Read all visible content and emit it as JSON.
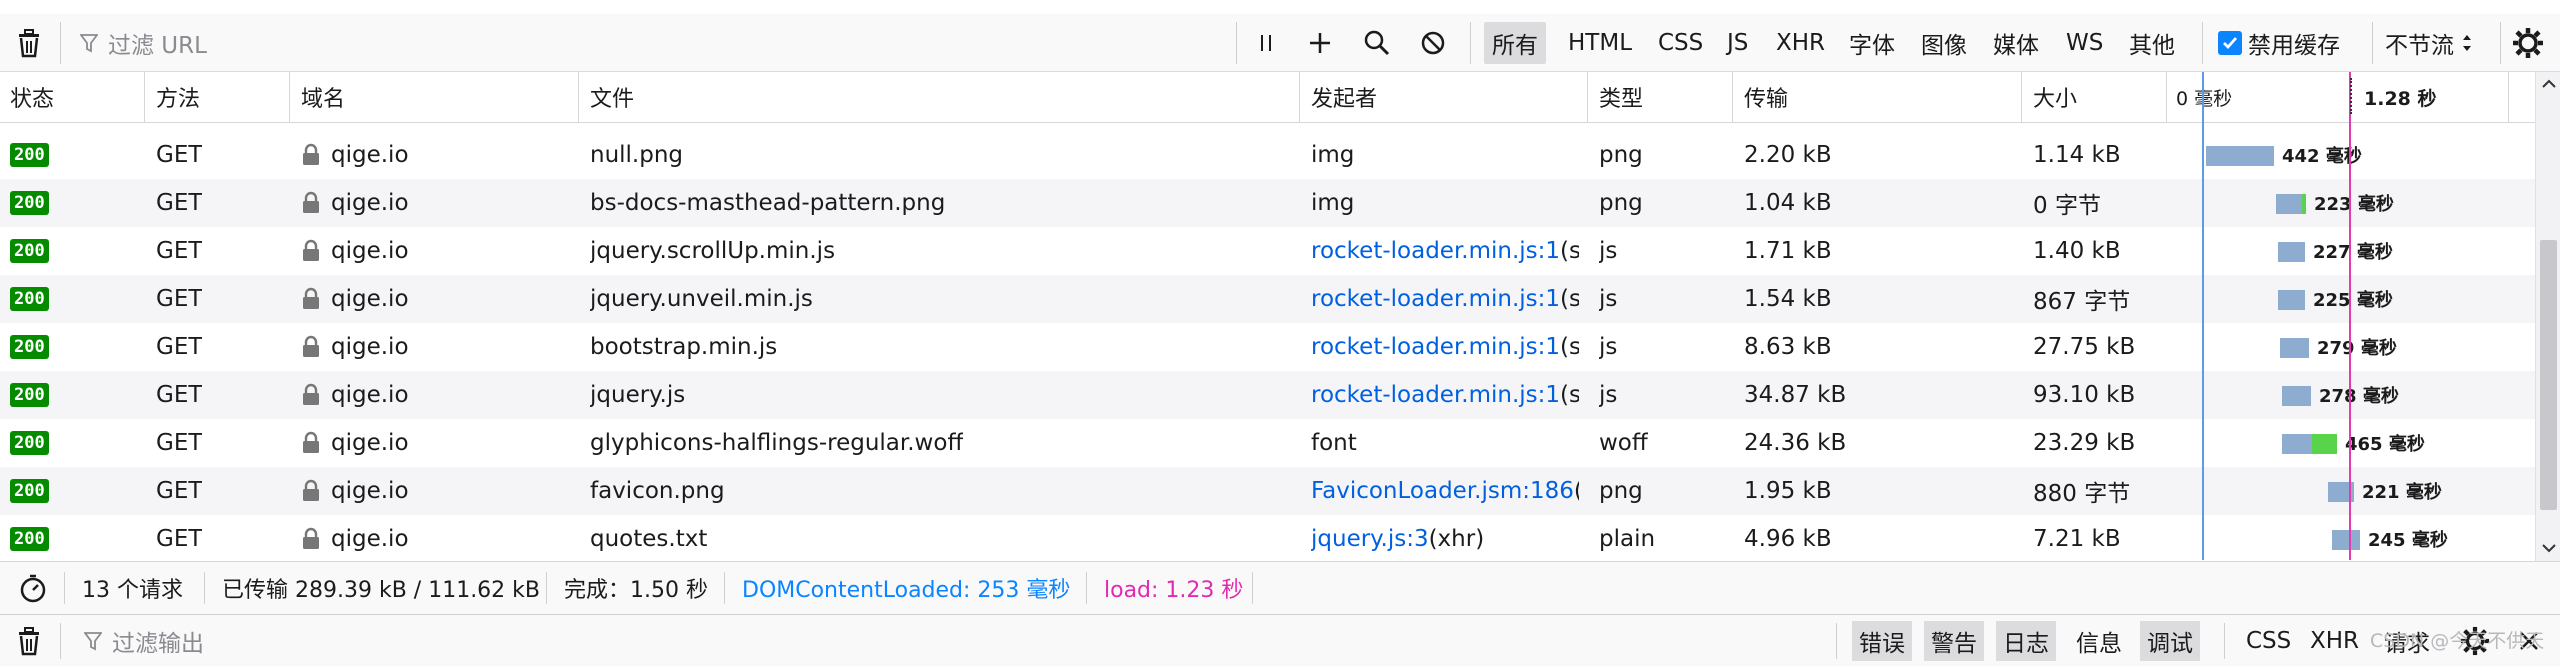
{
  "toolbar": {
    "filter_placeholder": "过滤 URL",
    "type_filters": [
      "所有",
      "HTML",
      "CSS",
      "JS",
      "XHR",
      "字体",
      "图像",
      "媒体",
      "WS",
      "其他"
    ],
    "active_filter": "所有",
    "disable_cache_label": "禁用缓存",
    "disable_cache_checked": true,
    "throttle_label": "不节流"
  },
  "columns": {
    "status": "状态",
    "method": "方法",
    "domain": "域名",
    "file": "文件",
    "initiator": "发起者",
    "type": "类型",
    "transfer": "传输",
    "size": "大小",
    "waterfall_start": "0 毫秒",
    "waterfall_end": "1.28 秒"
  },
  "rows": [
    {
      "status": "200",
      "method": "GET",
      "domain": "qige.io",
      "file": "null.png",
      "initiator": "img",
      "initiator_link": false,
      "type": "png",
      "transfer": "2.20 kB",
      "size": "1.14 kB",
      "timing": "442 毫秒",
      "wait_ms": 442,
      "recv_ms": 0
    },
    {
      "status": "200",
      "method": "GET",
      "domain": "qige.io",
      "file": "bs-docs-masthead-pattern.png",
      "initiator": "img",
      "initiator_link": false,
      "type": "png",
      "transfer": "1.04 kB",
      "size": "0 字节",
      "timing": "223 毫秒",
      "wait_ms": 210,
      "recv_ms": 13
    },
    {
      "status": "200",
      "method": "GET",
      "domain": "qige.io",
      "file": "jquery.scrollUp.min.js",
      "initiator": "rocket-loader.min.js:1",
      "initiator_extra": " (s...",
      "initiator_link": true,
      "type": "js",
      "transfer": "1.71 kB",
      "size": "1.40 kB",
      "timing": "227 毫秒",
      "wait_ms": 227,
      "recv_ms": 0
    },
    {
      "status": "200",
      "method": "GET",
      "domain": "qige.io",
      "file": "jquery.unveil.min.js",
      "initiator": "rocket-loader.min.js:1",
      "initiator_extra": " (s...",
      "initiator_link": true,
      "type": "js",
      "transfer": "1.54 kB",
      "size": "867 字节",
      "timing": "225 毫秒",
      "wait_ms": 225,
      "recv_ms": 0
    },
    {
      "status": "200",
      "method": "GET",
      "domain": "qige.io",
      "file": "bootstrap.min.js",
      "initiator": "rocket-loader.min.js:1",
      "initiator_extra": " (s...",
      "initiator_link": true,
      "type": "js",
      "transfer": "8.63 kB",
      "size": "27.75 kB",
      "timing": "279 毫秒",
      "wait_ms": 279,
      "recv_ms": 0
    },
    {
      "status": "200",
      "method": "GET",
      "domain": "qige.io",
      "file": "jquery.js",
      "initiator": "rocket-loader.min.js:1",
      "initiator_extra": " (s...",
      "initiator_link": true,
      "type": "js",
      "transfer": "34.87 kB",
      "size": "93.10 kB",
      "timing": "278 毫秒",
      "wait_ms": 278,
      "recv_ms": 0
    },
    {
      "status": "200",
      "method": "GET",
      "domain": "qige.io",
      "file": "glyphicons-halflings-regular.woff",
      "initiator": "font",
      "initiator_link": false,
      "type": "woff",
      "transfer": "24.36 kB",
      "size": "23.29 kB",
      "timing": "465 毫秒",
      "wait_ms": 300,
      "recv_ms": 165
    },
    {
      "status": "200",
      "method": "GET",
      "domain": "qige.io",
      "file": "favicon.png",
      "initiator": "FaviconLoader.jsm:186",
      "initiator_extra": " (...",
      "initiator_link": true,
      "type": "png",
      "transfer": "1.95 kB",
      "size": "880 字节",
      "timing": "221 毫秒",
      "wait_ms": 221,
      "recv_ms": 0
    },
    {
      "status": "200",
      "method": "GET",
      "domain": "qige.io",
      "file": "quotes.txt",
      "initiator": "jquery.js:3",
      "initiator_extra": " (xhr)",
      "initiator_link": true,
      "type": "plain",
      "transfer": "4.96 kB",
      "size": "7.21 kB",
      "timing": "245 毫秒",
      "wait_ms": 245,
      "recv_ms": 0
    }
  ],
  "status_bar": {
    "requests": "13 个请求",
    "transferred": "已传输 289.39 kB / 111.62 kB",
    "finish": "完成：1.50 秒",
    "dom_content_loaded": "DOMContentLoaded: 253 毫秒",
    "load": "load: 1.23 秒"
  },
  "console": {
    "filter_placeholder": "过滤输出",
    "buttons": [
      "错误",
      "警告",
      "日志",
      "信息",
      "调试",
      "CSS",
      "XHR",
      "请求"
    ],
    "active_buttons": [
      "错误",
      "警告",
      "日志",
      "调试"
    ],
    "watermark": "CSDN @今天不供天"
  },
  "colors": {
    "status_ok": "#058b00",
    "link": "#0060df",
    "dom_content_loaded": "#0a84ff",
    "load": "#e22ab0",
    "waterfall_wait": "#8daccf",
    "waterfall_receive": "#58d34a"
  },
  "icons": [
    "trash-icon",
    "funnel-icon",
    "pause-icon",
    "plus-icon",
    "search-icon",
    "block-icon",
    "gear-icon",
    "lock-icon",
    "stopwatch-icon"
  ]
}
